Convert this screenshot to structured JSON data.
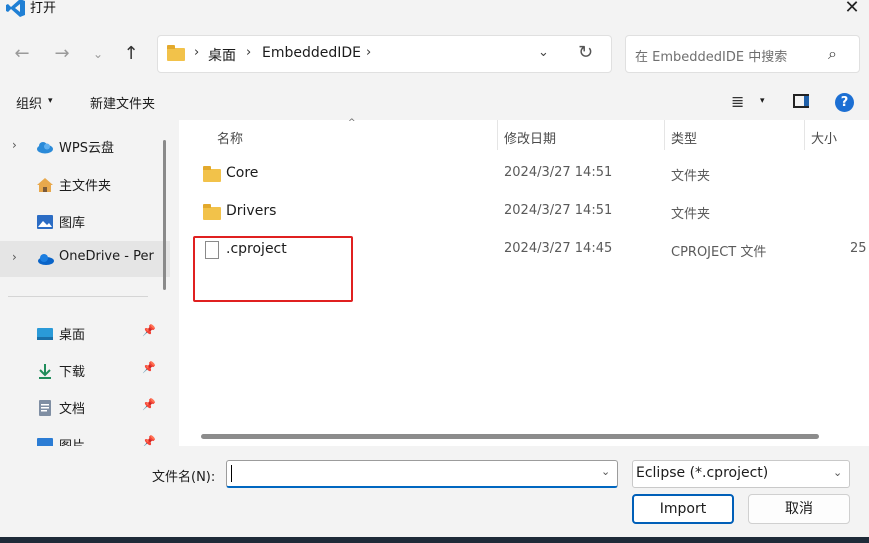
{
  "window": {
    "title": "打开",
    "close": "✕"
  },
  "nav": {
    "back": "←",
    "forward": "→",
    "recent": "⌄",
    "up": "↑"
  },
  "address": {
    "separator": "›",
    "crumbs": [
      "桌面",
      "EmbeddedIDE"
    ],
    "dropdown": "⌄",
    "refresh": "↻"
  },
  "search": {
    "placeholder": "在 EmbeddedIDE 中搜索",
    "icon": "⌕"
  },
  "toolbar": {
    "organize": "组织",
    "organize_arrow": "▾",
    "new_folder": "新建文件夹",
    "view": "≣",
    "view_arrow": "▾",
    "help": "?"
  },
  "sidebar": {
    "items": [
      {
        "label": "WPS云盘",
        "chevron": "›",
        "icon": "cloud-icon"
      },
      {
        "label": "主文件夹",
        "icon": "home-icon"
      },
      {
        "label": "图库",
        "icon": "gallery-icon"
      },
      {
        "label": "OneDrive - Per",
        "chevron": "›",
        "icon": "onedrive-icon"
      },
      {
        "label": "桌面",
        "pin": "📌",
        "icon": "desktop-icon"
      },
      {
        "label": "下载",
        "pin": "📌",
        "icon": "download-icon"
      },
      {
        "label": "文档",
        "pin": "📌",
        "icon": "document-icon"
      },
      {
        "label": "图片",
        "pin": "📌",
        "icon": "pictures-icon"
      }
    ]
  },
  "columns": {
    "name": "名称",
    "sort": "^",
    "modified": "修改日期",
    "type": "类型",
    "size": "大小"
  },
  "files": [
    {
      "name": "Core",
      "modified": "2024/3/27 14:51",
      "type": "文件夹",
      "size": "",
      "kind": "folder"
    },
    {
      "name": "Drivers",
      "modified": "2024/3/27 14:51",
      "type": "文件夹",
      "size": "",
      "kind": "folder"
    },
    {
      "name": ".cproject",
      "modified": "2024/3/27 14:45",
      "type": "CPROJECT 文件",
      "size": "25",
      "kind": "file"
    }
  ],
  "bottom": {
    "filename_label": "文件名(N):",
    "filename_value": "",
    "filename_drop": "⌄",
    "filter": "Eclipse (*.cproject)",
    "filter_drop": "⌄",
    "import": "Import",
    "cancel": "取消"
  },
  "colors": {
    "highlight": "#e02020",
    "accent": "#005fb8"
  }
}
